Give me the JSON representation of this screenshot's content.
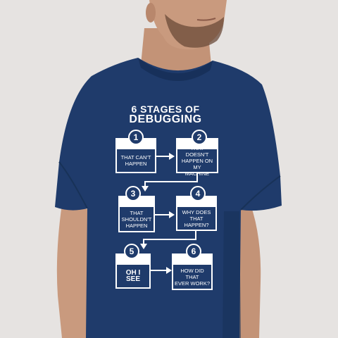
{
  "photo": {
    "subject": "man wearing navy t-shirt",
    "colors": {
      "background": "#e6e3e1",
      "shirt": "#1f3b6b",
      "skin": "#c99a7e",
      "print": "#ffffff"
    }
  },
  "print": {
    "title_line1": "6 STAGES OF",
    "title_line2": "DEBUGGING",
    "stages": [
      {
        "number": "1",
        "text": "THAT CAN'T\nHAPPEN"
      },
      {
        "number": "2",
        "text": "THAT DOESN'T\nHAPPEN ON MY\nMACHINE"
      },
      {
        "number": "3",
        "text": "THAT SHOULDN'T\nHAPPEN"
      },
      {
        "number": "4",
        "text": "WHY DOES\nTHAT HAPPEN?"
      },
      {
        "number": "5",
        "text": "OH I SEE"
      },
      {
        "number": "6",
        "text": "HOW DID THAT\nEVER WORK?"
      }
    ]
  }
}
